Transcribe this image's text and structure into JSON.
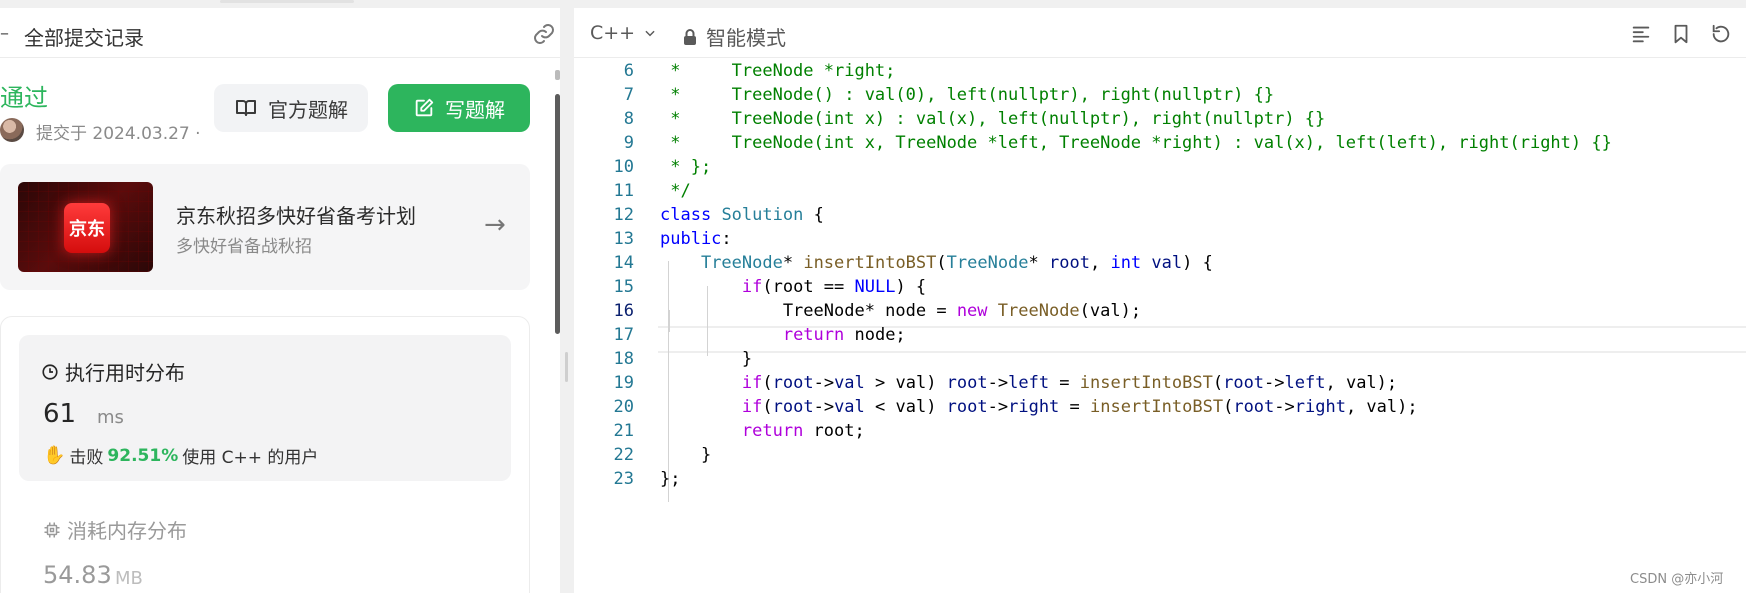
{
  "left_panel": {
    "header_title": "全部提交记录",
    "status": "通过",
    "submitted_at": "提交于 2024.03.27 ·",
    "official_solution_label": "官方题解",
    "write_solution_label": "写题解",
    "promo": {
      "badge_text": "京东",
      "title": "京东秋招多快好省备考计划",
      "subtitle": "多快好省备战秋招"
    },
    "runtime": {
      "title": "执行用时分布",
      "value": "61",
      "unit": "ms",
      "beat_label": "击败",
      "beat_percent": "92.51%",
      "beat_suffix": "使用 C++ 的用户"
    },
    "memory": {
      "title": "消耗内存分布",
      "value": "54.83",
      "unit": "MB"
    }
  },
  "editor": {
    "language": "C++",
    "mode": "智能模式",
    "line_numbers": [
      "6",
      "7",
      "8",
      "9",
      "10",
      "11",
      "12",
      "13",
      "14",
      "15",
      "16",
      "17",
      "18",
      "19",
      "20",
      "21",
      "22",
      "23"
    ],
    "active_line": "16"
  },
  "watermark": "CSDN @亦小河"
}
